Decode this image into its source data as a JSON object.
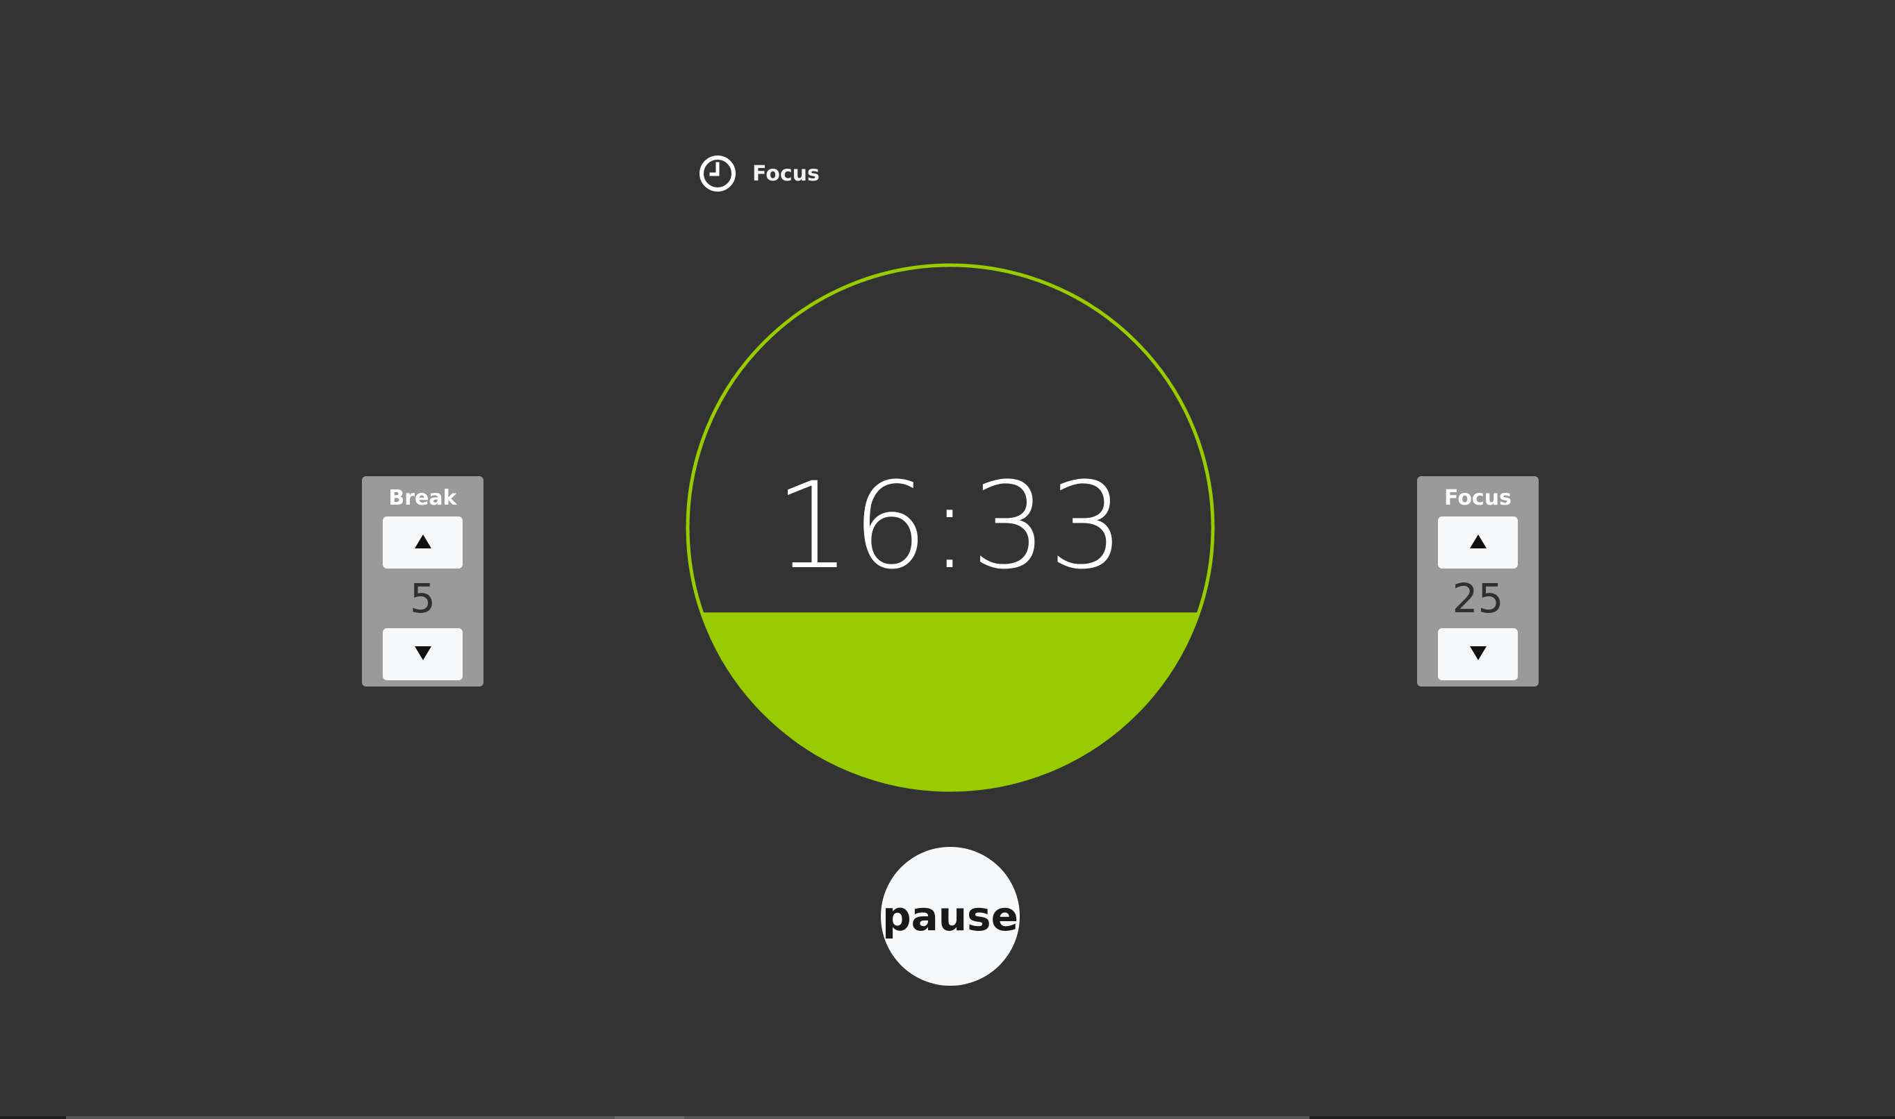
{
  "mode": {
    "label": "Focus",
    "icon": "clock-icon"
  },
  "timer": {
    "time": "16:33",
    "progress": 0.34,
    "accent_color": "#99cc00"
  },
  "break_stepper": {
    "label": "Break",
    "value": "5",
    "up_icon": "triangle-up-icon",
    "down_icon": "triangle-down-icon"
  },
  "focus_stepper": {
    "label": "Focus",
    "value": "25",
    "up_icon": "triangle-up-icon",
    "down_icon": "triangle-down-icon"
  },
  "controls": {
    "pause_label": "pause"
  },
  "colors": {
    "background": "#333333",
    "panel": "#9a9a9a",
    "button": "#f7f8fa"
  }
}
